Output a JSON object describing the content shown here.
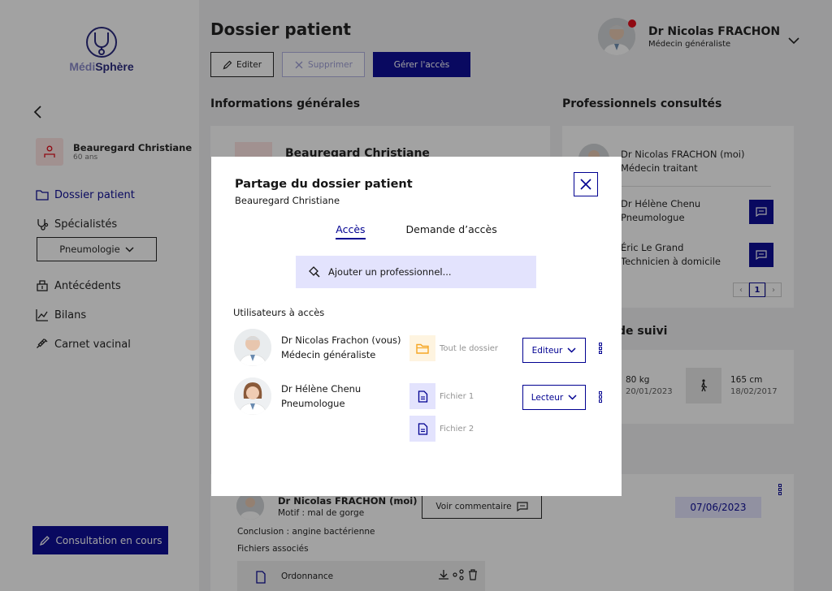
{
  "app": {
    "name_part1": "Médi",
    "name_part2": "Sphère"
  },
  "sidebar": {
    "patient": {
      "name": "Beauregard Christiane",
      "age": "60 ans"
    },
    "items": [
      {
        "label": "Dossier patient",
        "icon": "folder-icon"
      },
      {
        "label": "Spécialistés",
        "icon": "stethoscope-icon"
      },
      {
        "label": "Antécédents",
        "icon": "history-icon"
      },
      {
        "label": "Bilans",
        "icon": "chart-icon"
      },
      {
        "label": "Carnet vacinal",
        "icon": "syringe-icon"
      }
    ],
    "specialty_select": "Pneumologie",
    "consult_button": "Consultation en cours"
  },
  "header": {
    "title": "Dossier patient",
    "edit_label": "Editer",
    "delete_label": "Supprimer",
    "access_label": "Gérer l'accès",
    "user": {
      "name": "Dr Nicolas FRACHON",
      "role": "Médecin généraliste"
    }
  },
  "general_info": {
    "heading": "Informations générales",
    "patient_name": "Beauregard Christiane"
  },
  "professionals": {
    "heading": "Professionnels consultés",
    "items": [
      {
        "name": "Dr Nicolas FRACHON (moi)",
        "role": "Médecin traitant"
      },
      {
        "name": "Dr Hélène Chenu",
        "role": "Pneumologue"
      },
      {
        "name": "Éric Le Grand",
        "role": "Technicien à domicile"
      }
    ],
    "page": "1"
  },
  "followup": {
    "heading_fragment": "de suivi",
    "weight": "80 kg",
    "weight_date": "20/01/2023",
    "height": "165 cm",
    "height_date": "18/02/2017"
  },
  "consultation": {
    "doctor": "Dr Nicolas FRACHON (moi)",
    "motif": "Motif : mal de gorge",
    "comment_button": "Voir commentaire",
    "date": "07/06/2023",
    "conclusion": "Conclusion : angine bactérienne",
    "files_label": "Fichiers associés",
    "file": "Ordonnance"
  },
  "modal": {
    "title": "Partage du dossier patient",
    "subtitle": "Beauregard Christiane",
    "tabs": [
      "Accès",
      "Demande d’accès"
    ],
    "search_placeholder": "Ajouter un professionnel...",
    "users_label": "Utilisateurs à accès",
    "users": [
      {
        "name": "Dr Nicolas Frachon (vous)",
        "role": "Médecin généraliste",
        "scopes": [
          "Tout le dossier"
        ],
        "permission": "Editeur"
      },
      {
        "name": "Dr Hélène Chenu",
        "role": "Pneumologue",
        "scopes": [
          "Fichier 1",
          "Fichier 2"
        ],
        "permission": "Lecteur"
      }
    ]
  },
  "colors": {
    "primary": "#000091",
    "primary_light": "#e3e3fd",
    "folder_bg": "#fef4e0",
    "folder_icon": "#f5a623",
    "alert": "#e1000f"
  }
}
